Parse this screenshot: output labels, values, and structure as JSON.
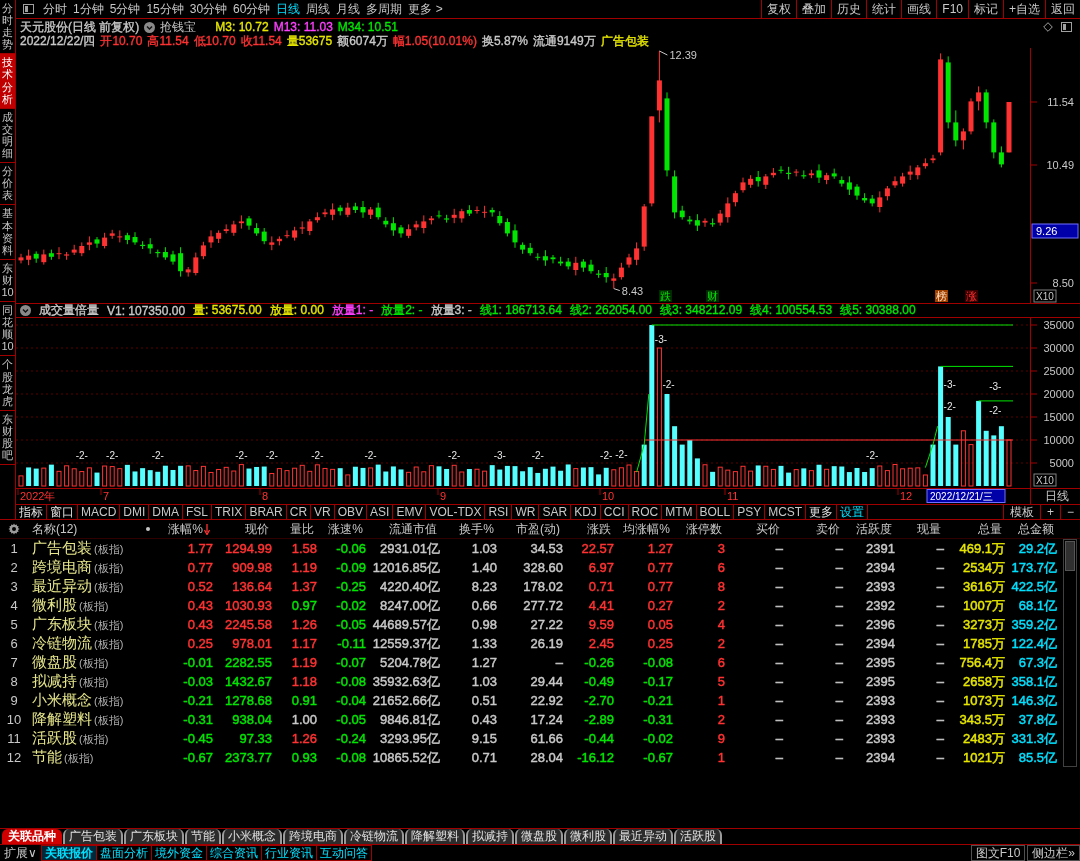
{
  "left_tabs": [
    {
      "label": "分时走势",
      "selected": false
    },
    {
      "label": "技术分析",
      "selected": true
    },
    {
      "label": "成交明细",
      "selected": false
    },
    {
      "label": "分价表",
      "selected": false
    },
    {
      "label": "基本资料",
      "selected": false
    },
    {
      "label": "东财10",
      "selected": false
    },
    {
      "label": "同花顺10",
      "selected": false
    },
    {
      "label": "个股龙虎",
      "selected": false
    },
    {
      "label": "东财股吧",
      "selected": false
    }
  ],
  "toolbar": {
    "periods": [
      {
        "label": "分时",
        "selected": false
      },
      {
        "label": "1分钟",
        "selected": false
      },
      {
        "label": "5分钟",
        "selected": false
      },
      {
        "label": "15分钟",
        "selected": false
      },
      {
        "label": "30分钟",
        "selected": false
      },
      {
        "label": "60分钟",
        "selected": false
      },
      {
        "label": "日线",
        "selected": true
      },
      {
        "label": "周线",
        "selected": false
      },
      {
        "label": "月线",
        "selected": false
      },
      {
        "label": "多周期",
        "selected": false
      }
    ],
    "more": "更多 >",
    "actions": [
      "复权",
      "叠加",
      "历史",
      "统计",
      "画线",
      "F10",
      "标记",
      "+自选",
      "返回"
    ]
  },
  "quote": {
    "title": "天元股份(日线 前复权)",
    "formula": "抢钱宝",
    "averages": [
      {
        "text": "M3: 10.72",
        "color": "#e6e600"
      },
      {
        "text": "M13: 11.03",
        "color": "#ff40ff"
      },
      {
        "text": "M34: 10.51",
        "color": "#00e600"
      }
    ],
    "stats": [
      {
        "text": "2022/12/22/四",
        "color": "#c8c8c8"
      },
      {
        "text": "开10.70",
        "color": "#ff3232"
      },
      {
        "text": "高11.54",
        "color": "#ff3232"
      },
      {
        "text": "低10.70",
        "color": "#ff3232"
      },
      {
        "text": "收11.54",
        "color": "#ff3232"
      },
      {
        "text": "量53675",
        "color": "#e6e600"
      },
      {
        "text": "额6074万",
        "color": "#c8c8c8"
      },
      {
        "text": "幅1.05(10.01%)",
        "color": "#ff3232"
      },
      {
        "text": "换5.87%",
        "color": "#c8c8c8"
      },
      {
        "text": "流通9149万",
        "color": "#c8c8c8"
      },
      {
        "text": "广告包装",
        "color": "#e6e600"
      }
    ]
  },
  "price_chart": {
    "axis": [
      {
        "label": "11.54",
        "kind": "tick"
      },
      {
        "label": "10.49",
        "kind": "tick"
      },
      {
        "label": "9.26",
        "kind": "cursor"
      },
      {
        "label": "8.50",
        "kind": "tick"
      }
    ],
    "scale": "X10",
    "high": "12.39",
    "low": "8.43",
    "events": [
      {
        "label": "跌",
        "kind": "fall"
      },
      {
        "label": "财",
        "kind": "news"
      },
      {
        "label": "榜",
        "kind": "rank"
      },
      {
        "label": "涨",
        "kind": "rise"
      }
    ],
    "chart_data": {
      "type": "candlestick",
      "ohlc": [
        [
          8.9,
          9.01,
          8.85,
          8.95
        ],
        [
          8.91,
          9.08,
          8.82,
          8.98
        ],
        [
          9.01,
          9.05,
          8.86,
          8.93
        ],
        [
          8.87,
          9.08,
          8.83,
          9.0
        ],
        [
          9.02,
          9.08,
          8.91,
          8.96
        ],
        [
          9.01,
          9.12,
          8.92,
          9.02
        ],
        [
          8.98,
          9.04,
          8.91,
          9.0
        ],
        [
          9.03,
          9.16,
          8.99,
          9.08
        ],
        [
          9.02,
          9.2,
          8.97,
          9.14
        ],
        [
          9.16,
          9.3,
          9.07,
          9.2
        ],
        [
          9.25,
          9.29,
          9.11,
          9.18
        ],
        [
          9.14,
          9.36,
          9.1,
          9.28
        ],
        [
          9.31,
          9.41,
          9.26,
          9.35
        ],
        [
          9.29,
          9.4,
          9.2,
          9.3
        ],
        [
          9.32,
          9.36,
          9.17,
          9.24
        ],
        [
          9.29,
          9.37,
          9.16,
          9.2
        ],
        [
          9.16,
          9.22,
          9.09,
          9.14
        ],
        [
          9.17,
          9.27,
          9.01,
          9.1
        ],
        [
          9.04,
          9.08,
          8.95,
          9.02
        ],
        [
          9.04,
          9.12,
          8.91,
          8.95
        ],
        [
          9.0,
          9.06,
          8.83,
          8.88
        ],
        [
          9.02,
          9.12,
          8.63,
          8.72
        ],
        [
          8.7,
          8.79,
          8.63,
          8.75
        ],
        [
          8.69,
          9.03,
          8.65,
          8.95
        ],
        [
          8.97,
          9.21,
          8.92,
          9.15
        ],
        [
          9.2,
          9.4,
          9.11,
          9.3
        ],
        [
          9.26,
          9.4,
          9.19,
          9.36
        ],
        [
          9.39,
          9.5,
          9.35,
          9.42
        ],
        [
          9.36,
          9.56,
          9.31,
          9.5
        ],
        [
          9.52,
          9.65,
          9.43,
          9.55
        ],
        [
          9.6,
          9.64,
          9.41,
          9.48
        ],
        [
          9.44,
          9.52,
          9.31,
          9.35
        ],
        [
          9.38,
          9.44,
          9.17,
          9.22
        ],
        [
          9.16,
          9.3,
          9.07,
          9.2
        ],
        [
          9.22,
          9.3,
          9.15,
          9.26
        ],
        [
          9.31,
          9.4,
          9.27,
          9.32
        ],
        [
          9.28,
          9.46,
          9.23,
          9.4
        ],
        [
          9.43,
          9.55,
          9.34,
          9.45
        ],
        [
          9.39,
          9.59,
          9.32,
          9.55
        ],
        [
          9.57,
          9.7,
          9.53,
          9.62
        ],
        [
          9.67,
          9.76,
          9.62,
          9.7
        ],
        [
          9.66,
          9.85,
          9.57,
          9.75
        ],
        [
          9.78,
          9.82,
          9.65,
          9.72
        ],
        [
          9.66,
          9.86,
          9.62,
          9.78
        ],
        [
          9.8,
          9.86,
          9.69,
          9.74
        ],
        [
          9.79,
          9.89,
          9.61,
          9.7
        ],
        [
          9.66,
          9.79,
          9.59,
          9.75
        ],
        [
          9.78,
          9.86,
          9.58,
          9.62
        ],
        [
          9.56,
          9.62,
          9.45,
          9.5
        ],
        [
          9.52,
          9.62,
          9.31,
          9.4
        ],
        [
          9.45,
          9.49,
          9.28,
          9.35
        ],
        [
          9.31,
          9.5,
          9.27,
          9.42
        ],
        [
          9.45,
          9.56,
          9.4,
          9.5
        ],
        [
          9.44,
          9.65,
          9.35,
          9.55
        ],
        [
          9.57,
          9.64,
          9.5,
          9.6
        ],
        [
          9.65,
          9.73,
          9.6,
          9.64
        ],
        [
          9.6,
          9.66,
          9.53,
          9.58
        ],
        [
          9.61,
          9.76,
          9.52,
          9.66
        ],
        [
          9.6,
          9.76,
          9.53,
          9.72
        ],
        [
          9.74,
          9.82,
          9.64,
          9.68
        ],
        [
          9.73,
          9.8,
          9.68,
          9.74
        ],
        [
          9.7,
          9.81,
          9.61,
          9.71
        ],
        [
          9.74,
          9.78,
          9.63,
          9.7
        ],
        [
          9.64,
          9.72,
          9.48,
          9.52
        ],
        [
          9.54,
          9.6,
          9.3,
          9.35
        ],
        [
          9.4,
          9.5,
          9.11,
          9.2
        ],
        [
          9.16,
          9.2,
          9.01,
          9.08
        ],
        [
          9.11,
          9.19,
          8.98,
          9.02
        ],
        [
          8.96,
          9.02,
          8.9,
          8.95
        ],
        [
          8.97,
          9.07,
          8.81,
          8.9
        ],
        [
          8.95,
          8.99,
          8.85,
          8.92
        ],
        [
          8.88,
          8.96,
          8.81,
          8.85
        ],
        [
          8.88,
          8.94,
          8.75,
          8.8
        ],
        [
          8.74,
          8.96,
          8.65,
          8.86
        ],
        [
          8.88,
          8.92,
          8.71,
          8.78
        ],
        [
          8.83,
          8.91,
          8.68,
          8.72
        ],
        [
          8.68,
          8.74,
          8.61,
          8.66
        ],
        [
          8.69,
          8.79,
          8.53,
          8.62
        ],
        [
          8.56,
          8.68,
          8.43,
          8.6
        ],
        [
          8.62,
          8.86,
          8.58,
          8.78
        ],
        [
          8.83,
          9.01,
          8.78,
          8.95
        ],
        [
          8.91,
          9.2,
          8.82,
          9.1
        ],
        [
          9.13,
          9.84,
          9.06,
          9.8
        ],
        [
          9.85,
          11.3,
          9.8,
          11.3
        ],
        [
          11.4,
          12.39,
          11.2,
          11.9
        ],
        [
          11.6,
          11.7,
          10.3,
          10.4
        ],
        [
          10.3,
          10.4,
          9.6,
          9.7
        ],
        [
          9.73,
          9.81,
          9.58,
          9.62
        ],
        [
          9.58,
          9.64,
          9.5,
          9.55
        ],
        [
          9.57,
          9.67,
          9.39,
          9.48
        ],
        [
          9.53,
          9.6,
          9.46,
          9.56
        ],
        [
          9.52,
          9.6,
          9.46,
          9.5
        ],
        [
          9.53,
          9.74,
          9.48,
          9.68
        ],
        [
          9.62,
          9.95,
          9.53,
          9.85
        ],
        [
          9.87,
          10.06,
          9.8,
          10.02
        ],
        [
          10.07,
          10.28,
          10.03,
          10.2
        ],
        [
          10.16,
          10.32,
          10.11,
          10.26
        ],
        [
          10.29,
          10.39,
          10.13,
          10.22
        ],
        [
          10.16,
          10.34,
          10.09,
          10.3
        ],
        [
          10.32,
          10.44,
          10.28,
          10.36
        ],
        [
          10.41,
          10.47,
          10.35,
          10.4
        ],
        [
          10.36,
          10.46,
          10.25,
          10.34
        ],
        [
          10.37,
          10.42,
          10.3,
          10.38
        ],
        [
          10.32,
          10.4,
          10.26,
          10.3
        ],
        [
          10.32,
          10.41,
          10.27,
          10.35
        ],
        [
          10.4,
          10.5,
          10.19,
          10.28
        ],
        [
          10.24,
          10.36,
          10.17,
          10.32
        ],
        [
          10.35,
          10.43,
          10.26,
          10.3
        ],
        [
          10.24,
          10.3,
          10.13,
          10.18
        ],
        [
          10.2,
          10.3,
          9.99,
          10.08
        ],
        [
          10.13,
          10.17,
          9.91,
          9.98
        ],
        [
          9.94,
          10.02,
          9.86,
          9.9
        ],
        [
          9.93,
          9.99,
          9.8,
          9.85
        ],
        [
          9.79,
          10.05,
          9.7,
          9.95
        ],
        [
          9.97,
          10.14,
          9.9,
          10.1
        ],
        [
          10.15,
          10.3,
          10.11,
          10.22
        ],
        [
          10.18,
          10.36,
          10.13,
          10.3
        ],
        [
          10.33,
          10.48,
          10.24,
          10.38
        ],
        [
          10.32,
          10.49,
          10.25,
          10.45
        ],
        [
          10.47,
          10.6,
          10.43,
          10.52
        ],
        [
          10.57,
          10.66,
          10.52,
          10.6
        ],
        [
          10.7,
          12.35,
          10.65,
          12.25
        ],
        [
          12.2,
          12.3,
          11.1,
          11.2
        ],
        [
          11.2,
          11.4,
          10.8,
          10.9
        ],
        [
          10.9,
          11.1,
          10.75,
          11.05
        ],
        [
          11.05,
          11.6,
          11.0,
          11.55
        ],
        [
          11.55,
          11.8,
          11.4,
          11.7
        ],
        [
          11.7,
          11.75,
          11.1,
          11.2
        ],
        [
          11.2,
          11.25,
          10.6,
          10.7
        ],
        [
          10.7,
          10.8,
          10.45,
          10.5
        ],
        [
          10.7,
          11.54,
          10.7,
          11.54
        ]
      ]
    }
  },
  "volume_panel": {
    "title": "成交量倍量",
    "readings": [
      {
        "text": "V1: 107350.00",
        "color": "#c8c8c8"
      },
      {
        "text": "量: 53675.00",
        "color": "#e6e600"
      },
      {
        "text": "放量: 0.00",
        "color": "#e6e600"
      },
      {
        "text": "放量1: -",
        "color": "#ff40ff"
      },
      {
        "text": "放量2: -",
        "color": "#00e600"
      },
      {
        "text": "放量3: -",
        "color": "#c8c8c8"
      },
      {
        "text": "线1: 186713.64",
        "color": "#00e600"
      },
      {
        "text": "线2: 262054.00",
        "color": "#00e600"
      },
      {
        "text": "线3: 348212.09",
        "color": "#00e600"
      },
      {
        "text": "线4: 100554.53",
        "color": "#00e600"
      },
      {
        "text": "线5: 30388.00",
        "color": "#00e600"
      }
    ],
    "axis": [
      "35000",
      "30000",
      "25000",
      "20000",
      "15000",
      "10000",
      "5000"
    ],
    "scale": "X10",
    "marks": [
      "-2-",
      "-2-",
      "-2-",
      "-2-",
      "-2-",
      "-2-",
      "-2-",
      "-2-",
      "-3-",
      "-2-",
      "-2-",
      "-2-",
      "-2-",
      "-3-",
      "-2-",
      "-3-",
      "-2-",
      "-3-",
      "-2-"
    ]
  },
  "date_axis": {
    "labels": [
      "2022年",
      "7",
      "8",
      "9",
      "10",
      "11",
      "12"
    ],
    "cursor_date": "2022/12/21/三",
    "period": "日线"
  },
  "indicator_tabs": {
    "items": [
      {
        "label": "指标",
        "kind": "menu"
      },
      {
        "label": "窗口",
        "kind": "menu"
      },
      {
        "label": "MACD",
        "kind": "indicator"
      },
      {
        "label": "DMI",
        "kind": "indicator"
      },
      {
        "label": "DMA",
        "kind": "indicator"
      },
      {
        "label": "FSL",
        "kind": "indicator"
      },
      {
        "label": "TRIX",
        "kind": "indicator"
      },
      {
        "label": "BRAR",
        "kind": "indicator"
      },
      {
        "label": "CR",
        "kind": "indicator"
      },
      {
        "label": "VR",
        "kind": "indicator"
      },
      {
        "label": "OBV",
        "kind": "indicator"
      },
      {
        "label": "ASI",
        "kind": "indicator"
      },
      {
        "label": "EMV",
        "kind": "indicator"
      },
      {
        "label": "VOL-TDX",
        "kind": "indicator"
      },
      {
        "label": "RSI",
        "kind": "indicator"
      },
      {
        "label": "WR",
        "kind": "indicator"
      },
      {
        "label": "SAR",
        "kind": "indicator"
      },
      {
        "label": "KDJ",
        "kind": "indicator"
      },
      {
        "label": "CCI",
        "kind": "indicator"
      },
      {
        "label": "ROC",
        "kind": "indicator"
      },
      {
        "label": "MTM",
        "kind": "indicator"
      },
      {
        "label": "BOLL",
        "kind": "indicator"
      },
      {
        "label": "PSY",
        "kind": "indicator"
      },
      {
        "label": "MCST",
        "kind": "indicator"
      },
      {
        "label": "更多",
        "kind": "menu"
      },
      {
        "label": "设置",
        "kind": "link"
      }
    ],
    "right": [
      "模板",
      "+",
      "−"
    ]
  },
  "table": {
    "columns": [
      {
        "label": "名称(12)",
        "sorted": false
      },
      {
        "label": "涨幅%",
        "sorted": true
      },
      {
        "label": "现价",
        "sorted": false
      },
      {
        "label": "量比",
        "sorted": false
      },
      {
        "label": "涨速%",
        "sorted": false
      },
      {
        "label": "流通市值",
        "sorted": false
      },
      {
        "label": "换手%",
        "sorted": false
      },
      {
        "label": "市盈(动)",
        "sorted": false
      },
      {
        "label": "涨跌",
        "sorted": false
      },
      {
        "label": "均涨幅%",
        "sorted": false
      },
      {
        "label": "涨停数",
        "sorted": false
      },
      {
        "label": "买价",
        "sorted": false
      },
      {
        "label": "卖价",
        "sorted": false
      },
      {
        "label": "活跃度",
        "sorted": false
      },
      {
        "label": "现量",
        "sorted": false
      },
      {
        "label": "总量",
        "sorted": false
      },
      {
        "label": "总金额",
        "sorted": false
      }
    ],
    "rows": [
      {
        "no": "1",
        "name": "广告包装",
        "tag": "(板指)",
        "values": [
          {
            "text": "1.77",
            "color": "#ff3232"
          },
          {
            "text": "1294.99",
            "color": "#ff3232"
          },
          {
            "text": "1.58",
            "color": "#ff3232"
          },
          {
            "text": "-0.06",
            "color": "#00e600"
          },
          {
            "text": "2931.01亿",
            "color": "#c8c8c8"
          },
          {
            "text": "1.03",
            "color": "#c8c8c8"
          },
          {
            "text": "34.53",
            "color": "#c8c8c8"
          },
          {
            "text": "22.57",
            "color": "#ff3232"
          },
          {
            "text": "1.27",
            "color": "#ff3232"
          },
          {
            "text": "3",
            "color": "#ff3232"
          },
          {
            "text": "–",
            "color": "#c8c8c8"
          },
          {
            "text": "–",
            "color": "#c8c8c8"
          },
          {
            "text": "2391",
            "color": "#c8c8c8"
          },
          {
            "text": "–",
            "color": "#c8c8c8"
          },
          {
            "text": "469.1万",
            "color": "#e6e600"
          },
          {
            "text": "29.2亿",
            "color": "#00e0ff"
          }
        ]
      },
      {
        "no": "2",
        "name": "跨境电商",
        "tag": "(板指)",
        "values": [
          {
            "text": "0.77",
            "color": "#ff3232"
          },
          {
            "text": "909.98",
            "color": "#ff3232"
          },
          {
            "text": "1.19",
            "color": "#ff3232"
          },
          {
            "text": "-0.09",
            "color": "#00e600"
          },
          {
            "text": "12016.85亿",
            "color": "#c8c8c8"
          },
          {
            "text": "1.40",
            "color": "#c8c8c8"
          },
          {
            "text": "328.60",
            "color": "#c8c8c8"
          },
          {
            "text": "6.97",
            "color": "#ff3232"
          },
          {
            "text": "0.77",
            "color": "#ff3232"
          },
          {
            "text": "6",
            "color": "#ff3232"
          },
          {
            "text": "–",
            "color": "#c8c8c8"
          },
          {
            "text": "–",
            "color": "#c8c8c8"
          },
          {
            "text": "2394",
            "color": "#c8c8c8"
          },
          {
            "text": "–",
            "color": "#c8c8c8"
          },
          {
            "text": "2534万",
            "color": "#e6e600"
          },
          {
            "text": "173.7亿",
            "color": "#00e0ff"
          }
        ]
      },
      {
        "no": "3",
        "name": "最近异动",
        "tag": "(板指)",
        "values": [
          {
            "text": "0.52",
            "color": "#ff3232"
          },
          {
            "text": "136.64",
            "color": "#ff3232"
          },
          {
            "text": "1.37",
            "color": "#ff3232"
          },
          {
            "text": "-0.25",
            "color": "#00e600"
          },
          {
            "text": "4220.40亿",
            "color": "#c8c8c8"
          },
          {
            "text": "8.23",
            "color": "#c8c8c8"
          },
          {
            "text": "178.02",
            "color": "#c8c8c8"
          },
          {
            "text": "0.71",
            "color": "#ff3232"
          },
          {
            "text": "0.77",
            "color": "#ff3232"
          },
          {
            "text": "8",
            "color": "#ff3232"
          },
          {
            "text": "–",
            "color": "#c8c8c8"
          },
          {
            "text": "–",
            "color": "#c8c8c8"
          },
          {
            "text": "2393",
            "color": "#c8c8c8"
          },
          {
            "text": "–",
            "color": "#c8c8c8"
          },
          {
            "text": "3616万",
            "color": "#e6e600"
          },
          {
            "text": "422.5亿",
            "color": "#00e0ff"
          }
        ]
      },
      {
        "no": "4",
        "name": "微利股",
        "tag": "(板指)",
        "values": [
          {
            "text": "0.43",
            "color": "#ff3232"
          },
          {
            "text": "1030.93",
            "color": "#ff3232"
          },
          {
            "text": "0.97",
            "color": "#00e600"
          },
          {
            "text": "-0.02",
            "color": "#00e600"
          },
          {
            "text": "8247.00亿",
            "color": "#c8c8c8"
          },
          {
            "text": "0.66",
            "color": "#c8c8c8"
          },
          {
            "text": "277.72",
            "color": "#c8c8c8"
          },
          {
            "text": "4.41",
            "color": "#ff3232"
          },
          {
            "text": "0.27",
            "color": "#ff3232"
          },
          {
            "text": "2",
            "color": "#ff3232"
          },
          {
            "text": "–",
            "color": "#c8c8c8"
          },
          {
            "text": "–",
            "color": "#c8c8c8"
          },
          {
            "text": "2392",
            "color": "#c8c8c8"
          },
          {
            "text": "–",
            "color": "#c8c8c8"
          },
          {
            "text": "1007万",
            "color": "#e6e600"
          },
          {
            "text": "68.1亿",
            "color": "#00e0ff"
          }
        ]
      },
      {
        "no": "5",
        "name": "广东板块",
        "tag": "(板指)",
        "values": [
          {
            "text": "0.43",
            "color": "#ff3232"
          },
          {
            "text": "2245.58",
            "color": "#ff3232"
          },
          {
            "text": "1.26",
            "color": "#ff3232"
          },
          {
            "text": "-0.05",
            "color": "#00e600"
          },
          {
            "text": "44689.57亿",
            "color": "#c8c8c8"
          },
          {
            "text": "0.98",
            "color": "#c8c8c8"
          },
          {
            "text": "27.22",
            "color": "#c8c8c8"
          },
          {
            "text": "9.59",
            "color": "#ff3232"
          },
          {
            "text": "0.05",
            "color": "#ff3232"
          },
          {
            "text": "4",
            "color": "#ff3232"
          },
          {
            "text": "–",
            "color": "#c8c8c8"
          },
          {
            "text": "–",
            "color": "#c8c8c8"
          },
          {
            "text": "2396",
            "color": "#c8c8c8"
          },
          {
            "text": "–",
            "color": "#c8c8c8"
          },
          {
            "text": "3273万",
            "color": "#e6e600"
          },
          {
            "text": "359.2亿",
            "color": "#00e0ff"
          }
        ]
      },
      {
        "no": "6",
        "name": "冷链物流",
        "tag": "(板指)",
        "values": [
          {
            "text": "0.25",
            "color": "#ff3232"
          },
          {
            "text": "978.01",
            "color": "#ff3232"
          },
          {
            "text": "1.17",
            "color": "#ff3232"
          },
          {
            "text": "-0.11",
            "color": "#00e600"
          },
          {
            "text": "12559.37亿",
            "color": "#c8c8c8"
          },
          {
            "text": "1.33",
            "color": "#c8c8c8"
          },
          {
            "text": "26.19",
            "color": "#c8c8c8"
          },
          {
            "text": "2.45",
            "color": "#ff3232"
          },
          {
            "text": "0.25",
            "color": "#ff3232"
          },
          {
            "text": "2",
            "color": "#ff3232"
          },
          {
            "text": "–",
            "color": "#c8c8c8"
          },
          {
            "text": "–",
            "color": "#c8c8c8"
          },
          {
            "text": "2394",
            "color": "#c8c8c8"
          },
          {
            "text": "–",
            "color": "#c8c8c8"
          },
          {
            "text": "1785万",
            "color": "#e6e600"
          },
          {
            "text": "122.4亿",
            "color": "#00e0ff"
          }
        ]
      },
      {
        "no": "7",
        "name": "微盘股",
        "tag": "(板指)",
        "values": [
          {
            "text": "-0.01",
            "color": "#00e600"
          },
          {
            "text": "2282.55",
            "color": "#00e600"
          },
          {
            "text": "1.19",
            "color": "#ff3232"
          },
          {
            "text": "-0.07",
            "color": "#00e600"
          },
          {
            "text": "5204.78亿",
            "color": "#c8c8c8"
          },
          {
            "text": "1.27",
            "color": "#c8c8c8"
          },
          {
            "text": "–",
            "color": "#c8c8c8"
          },
          {
            "text": "-0.26",
            "color": "#00e600"
          },
          {
            "text": "-0.08",
            "color": "#00e600"
          },
          {
            "text": "6",
            "color": "#ff3232"
          },
          {
            "text": "–",
            "color": "#c8c8c8"
          },
          {
            "text": "–",
            "color": "#c8c8c8"
          },
          {
            "text": "2395",
            "color": "#c8c8c8"
          },
          {
            "text": "–",
            "color": "#c8c8c8"
          },
          {
            "text": "756.4万",
            "color": "#e6e600"
          },
          {
            "text": "67.3亿",
            "color": "#00e0ff"
          }
        ]
      },
      {
        "no": "8",
        "name": "拟减持",
        "tag": "(板指)",
        "values": [
          {
            "text": "-0.03",
            "color": "#00e600"
          },
          {
            "text": "1432.67",
            "color": "#00e600"
          },
          {
            "text": "1.18",
            "color": "#ff3232"
          },
          {
            "text": "-0.08",
            "color": "#00e600"
          },
          {
            "text": "35932.63亿",
            "color": "#c8c8c8"
          },
          {
            "text": "1.03",
            "color": "#c8c8c8"
          },
          {
            "text": "29.44",
            "color": "#c8c8c8"
          },
          {
            "text": "-0.49",
            "color": "#00e600"
          },
          {
            "text": "-0.17",
            "color": "#00e600"
          },
          {
            "text": "5",
            "color": "#ff3232"
          },
          {
            "text": "–",
            "color": "#c8c8c8"
          },
          {
            "text": "–",
            "color": "#c8c8c8"
          },
          {
            "text": "2395",
            "color": "#c8c8c8"
          },
          {
            "text": "–",
            "color": "#c8c8c8"
          },
          {
            "text": "2658万",
            "color": "#e6e600"
          },
          {
            "text": "358.1亿",
            "color": "#00e0ff"
          }
        ]
      },
      {
        "no": "9",
        "name": "小米概念",
        "tag": "(板指)",
        "values": [
          {
            "text": "-0.21",
            "color": "#00e600"
          },
          {
            "text": "1278.68",
            "color": "#00e600"
          },
          {
            "text": "0.91",
            "color": "#00e600"
          },
          {
            "text": "-0.04",
            "color": "#00e600"
          },
          {
            "text": "21652.66亿",
            "color": "#c8c8c8"
          },
          {
            "text": "0.51",
            "color": "#c8c8c8"
          },
          {
            "text": "22.92",
            "color": "#c8c8c8"
          },
          {
            "text": "-2.70",
            "color": "#00e600"
          },
          {
            "text": "-0.21",
            "color": "#00e600"
          },
          {
            "text": "1",
            "color": "#ff3232"
          },
          {
            "text": "–",
            "color": "#c8c8c8"
          },
          {
            "text": "–",
            "color": "#c8c8c8"
          },
          {
            "text": "2393",
            "color": "#c8c8c8"
          },
          {
            "text": "–",
            "color": "#c8c8c8"
          },
          {
            "text": "1073万",
            "color": "#e6e600"
          },
          {
            "text": "146.3亿",
            "color": "#00e0ff"
          }
        ]
      },
      {
        "no": "10",
        "name": "降解塑料",
        "tag": "(板指)",
        "values": [
          {
            "text": "-0.31",
            "color": "#00e600"
          },
          {
            "text": "938.04",
            "color": "#00e600"
          },
          {
            "text": "1.00",
            "color": "#c8c8c8"
          },
          {
            "text": "-0.05",
            "color": "#00e600"
          },
          {
            "text": "9846.81亿",
            "color": "#c8c8c8"
          },
          {
            "text": "0.43",
            "color": "#c8c8c8"
          },
          {
            "text": "17.24",
            "color": "#c8c8c8"
          },
          {
            "text": "-2.89",
            "color": "#00e600"
          },
          {
            "text": "-0.31",
            "color": "#00e600"
          },
          {
            "text": "2",
            "color": "#ff3232"
          },
          {
            "text": "–",
            "color": "#c8c8c8"
          },
          {
            "text": "–",
            "color": "#c8c8c8"
          },
          {
            "text": "2393",
            "color": "#c8c8c8"
          },
          {
            "text": "–",
            "color": "#c8c8c8"
          },
          {
            "text": "343.5万",
            "color": "#e6e600"
          },
          {
            "text": "37.8亿",
            "color": "#00e0ff"
          }
        ]
      },
      {
        "no": "11",
        "name": "活跃股",
        "tag": "(板指)",
        "values": [
          {
            "text": "-0.45",
            "color": "#00e600"
          },
          {
            "text": "97.33",
            "color": "#00e600"
          },
          {
            "text": "1.26",
            "color": "#ff3232"
          },
          {
            "text": "-0.24",
            "color": "#00e600"
          },
          {
            "text": "3293.95亿",
            "color": "#c8c8c8"
          },
          {
            "text": "9.15",
            "color": "#c8c8c8"
          },
          {
            "text": "61.66",
            "color": "#c8c8c8"
          },
          {
            "text": "-0.44",
            "color": "#00e600"
          },
          {
            "text": "-0.02",
            "color": "#00e600"
          },
          {
            "text": "9",
            "color": "#ff3232"
          },
          {
            "text": "–",
            "color": "#c8c8c8"
          },
          {
            "text": "–",
            "color": "#c8c8c8"
          },
          {
            "text": "2393",
            "color": "#c8c8c8"
          },
          {
            "text": "–",
            "color": "#c8c8c8"
          },
          {
            "text": "2483万",
            "color": "#e6e600"
          },
          {
            "text": "331.3亿",
            "color": "#00e0ff"
          }
        ]
      },
      {
        "no": "12",
        "name": "节能",
        "tag": "(板指)",
        "values": [
          {
            "text": "-0.67",
            "color": "#00e600"
          },
          {
            "text": "2373.77",
            "color": "#00e600"
          },
          {
            "text": "0.93",
            "color": "#00e600"
          },
          {
            "text": "-0.08",
            "color": "#00e600"
          },
          {
            "text": "10865.52亿",
            "color": "#c8c8c8"
          },
          {
            "text": "0.71",
            "color": "#c8c8c8"
          },
          {
            "text": "28.04",
            "color": "#c8c8c8"
          },
          {
            "text": "-16.12",
            "color": "#00e600"
          },
          {
            "text": "-0.67",
            "color": "#00e600"
          },
          {
            "text": "1",
            "color": "#ff3232"
          },
          {
            "text": "–",
            "color": "#c8c8c8"
          },
          {
            "text": "–",
            "color": "#c8c8c8"
          },
          {
            "text": "2394",
            "color": "#c8c8c8"
          },
          {
            "text": "–",
            "color": "#c8c8c8"
          },
          {
            "text": "1021万",
            "color": "#e6e600"
          },
          {
            "text": "85.5亿",
            "color": "#00e0ff"
          }
        ]
      }
    ]
  },
  "related_tabs": [
    {
      "label": "关联品种",
      "selected": true
    },
    {
      "label": "广告包装",
      "selected": false
    },
    {
      "label": "广东板块",
      "selected": false
    },
    {
      "label": "节能",
      "selected": false
    },
    {
      "label": "小米概念",
      "selected": false
    },
    {
      "label": "跨境电商",
      "selected": false
    },
    {
      "label": "冷链物流",
      "selected": false
    },
    {
      "label": "降解塑料",
      "selected": false
    },
    {
      "label": "拟减持",
      "selected": false
    },
    {
      "label": "微盘股",
      "selected": false
    },
    {
      "label": "微利股",
      "selected": false
    },
    {
      "label": "最近异动",
      "selected": false
    },
    {
      "label": "活跃股",
      "selected": false
    }
  ],
  "bottom_bar": {
    "expand": "扩展∨",
    "tabs": [
      {
        "label": "关联报价",
        "selected": true
      },
      {
        "label": "盘面分析",
        "selected": false
      },
      {
        "label": "境外资金",
        "selected": false
      },
      {
        "label": "综合资讯",
        "selected": false
      },
      {
        "label": "行业资讯",
        "selected": false
      },
      {
        "label": "互动问答",
        "selected": false
      }
    ],
    "right": [
      "图文F10",
      "侧边栏»"
    ]
  }
}
